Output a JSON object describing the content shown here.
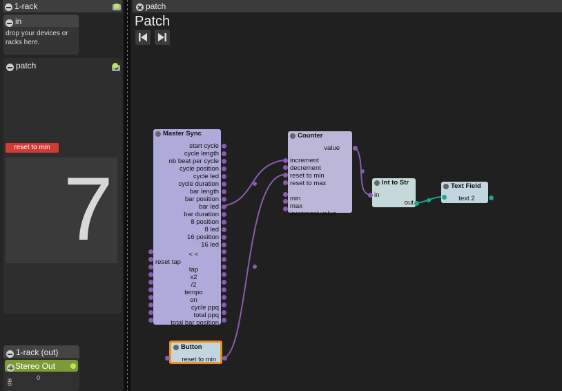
{
  "left_panel": {
    "rack_title": "1-rack",
    "in_module": {
      "title": "in",
      "hint": "drop your devices or racks here."
    },
    "patch_module": {
      "title": "patch",
      "reset_button": "reset to min",
      "display_value": "7"
    },
    "rack_out_title": "1-rack (out)",
    "stereo_out": {
      "title": "Stereo Out",
      "db_label": "dB",
      "db_value": "0"
    }
  },
  "tab": {
    "title": "patch"
  },
  "patch_view": {
    "title": "Patch"
  },
  "nodes": {
    "master_sync": {
      "title": "Master Sync",
      "outputs": [
        "start cycle",
        "cycle length",
        "nb beat per cycle",
        "cycle position",
        "cycle led",
        "cycle duration",
        "bar length",
        "bar position",
        "bar led",
        "bar duration",
        "8 position",
        "8 led",
        "16 position",
        "16 led"
      ],
      "inputs": [
        "< <",
        "reset tap",
        "tap",
        "x2",
        "/2",
        "tempo",
        "on",
        "cycle ppq",
        "total ppq",
        "total bar position"
      ]
    },
    "counter": {
      "title": "Counter",
      "output": "value",
      "inputs": [
        "increment",
        "decrement",
        "reset to min",
        "reset to max",
        "",
        "min",
        "max",
        "increment value"
      ]
    },
    "int_to_str": {
      "title": "Int to Str",
      "input": "in",
      "output": "out"
    },
    "text_field": {
      "title": "Text Field",
      "value": "text 2"
    },
    "button": {
      "title": "Button",
      "output": "reset to min"
    }
  },
  "colors": {
    "master_sync_bg": "#aeaad9",
    "counter_bg": "#bcb6d8",
    "int_to_str_bg": "#c6d9da",
    "text_field_bg": "#c2d6e0",
    "button_bg": "#c2d6e0",
    "button_border": "#f0901e",
    "wire_purple": "#8a5cb0",
    "wire_teal": "#19a888",
    "reset_button": "#d43a34",
    "stereo_out": "#7c9b34"
  }
}
